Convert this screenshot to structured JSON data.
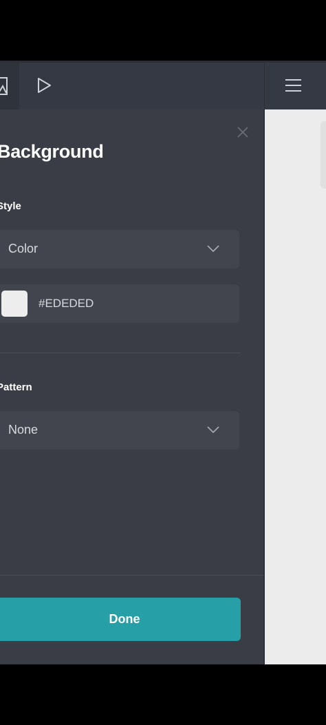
{
  "panel": {
    "title": "Background",
    "style_section": {
      "label": "Style",
      "select_value": "Color"
    },
    "color_field": {
      "hex_value": "#EDEDED",
      "swatch_color": "#EDEDED"
    },
    "pattern_section": {
      "label": "Pattern",
      "select_value": "None"
    },
    "done_label": "Done"
  },
  "toolbar": {
    "icons": [
      "image-icon",
      "play-icon",
      "menu-icon"
    ]
  },
  "colors": {
    "accent": "#26A0A6",
    "panel_bg": "#3A3D46",
    "field_bg": "#42454E",
    "canvas_bg": "#EBECEB"
  }
}
